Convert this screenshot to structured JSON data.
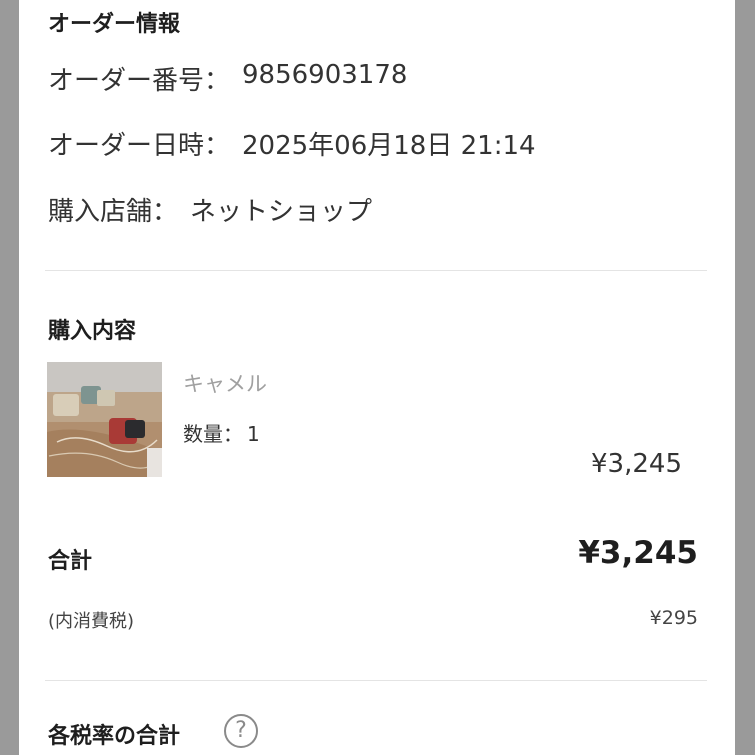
{
  "order_info": {
    "heading": "オーダー情報",
    "order_number": {
      "label": "オーダー番号：",
      "value": "9856903178"
    },
    "order_date": {
      "label": "オーダー日時：",
      "value": "2025年06月18日 21:14"
    },
    "store": {
      "label": "購入店舗：",
      "value": "ネットショップ"
    }
  },
  "purchase": {
    "heading": "購入内容",
    "items": [
      {
        "image_icon": "product-photo",
        "variant": "キャメル",
        "quantity_label": "数量：",
        "quantity": "1",
        "price": "¥3,245"
      }
    ]
  },
  "totals": {
    "total_label": "合計",
    "total_value": "¥3,245",
    "tax_label": "(内消費税)",
    "tax_value": "¥295"
  },
  "tax_rates": {
    "heading": "各税率の合計",
    "help_icon": "question-circle-icon",
    "help_glyph": "?"
  },
  "colors": {
    "background": "#9a9a9a",
    "card": "#ffffff",
    "text": "#333333",
    "muted": "#a0a0a0",
    "divider": "#e4e4e4"
  }
}
